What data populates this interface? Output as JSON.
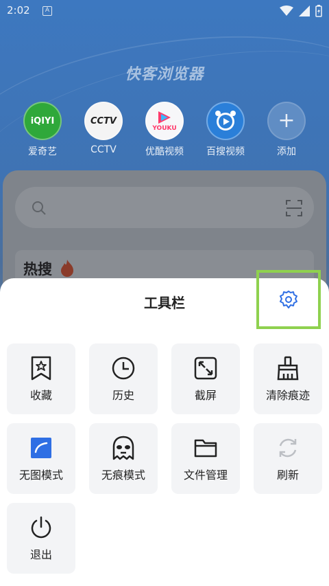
{
  "status": {
    "time": "2:02",
    "a_badge": "A"
  },
  "app": {
    "title": "快客浏览器"
  },
  "shortcuts": [
    {
      "label": "爱奇艺",
      "logo_text": "iQIYI"
    },
    {
      "label": "CCTV",
      "logo_text": "CCTV"
    },
    {
      "label": "优酷视频",
      "logo_text": "YOUKU"
    },
    {
      "label": "百搜视频",
      "logo_text": ""
    },
    {
      "label": "添加",
      "logo_text": "+"
    }
  ],
  "hot": {
    "title": "热搜"
  },
  "toolbar": {
    "title": "工具栏",
    "items": [
      {
        "label": "收藏",
        "icon": "bookmark-star-icon"
      },
      {
        "label": "历史",
        "icon": "clock-icon"
      },
      {
        "label": "截屏",
        "icon": "screenshot-icon"
      },
      {
        "label": "清除痕迹",
        "icon": "broom-icon"
      },
      {
        "label": "无图模式",
        "icon": "no-image-icon"
      },
      {
        "label": "无痕模式",
        "icon": "incognito-mask-icon"
      },
      {
        "label": "文件管理",
        "icon": "folder-icon"
      },
      {
        "label": "刷新",
        "icon": "refresh-icon"
      },
      {
        "label": "退出",
        "icon": "power-icon"
      }
    ]
  },
  "colors": {
    "accent": "#2f6fe4",
    "highlight_box": "#8fd14f"
  }
}
